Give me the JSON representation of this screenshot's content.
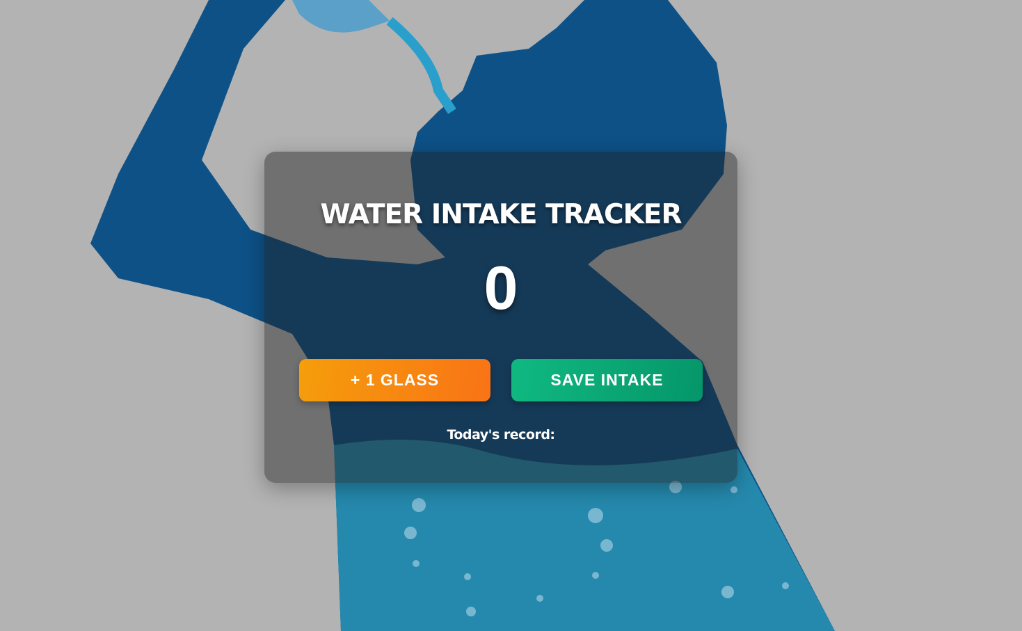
{
  "tracker": {
    "title": "WATER INTAKE TRACKER",
    "count": "0",
    "add_glass_label": "+ 1 GLASS",
    "save_label": "SAVE INTAKE",
    "record_label": "Today's record:"
  },
  "colors": {
    "background": "#b3b3b3",
    "silhouette": "#0d5187",
    "water": "#2589ad",
    "add_button": "#f59e0b",
    "save_button": "#10b981"
  }
}
